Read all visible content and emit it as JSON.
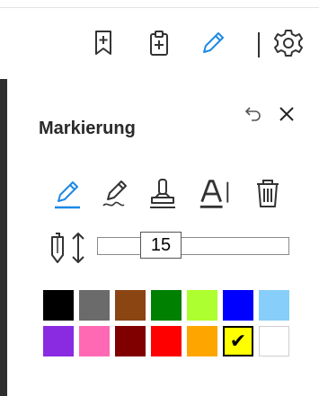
{
  "toolbar": {
    "icons": [
      "bookmark-add-icon",
      "clipboard-add-icon",
      "pen-icon",
      "settings-icon"
    ]
  },
  "panel": {
    "title": "Markierung",
    "tools": [
      "highlighter-pen-icon",
      "freehand-pen-icon",
      "stamp-icon",
      "text-highlight-icon",
      "delete-icon"
    ],
    "active_tool": "highlighter-pen-icon",
    "stroke_size": "15",
    "colors": {
      "row1": [
        "#000000",
        "#6b6b6b",
        "#8b4513",
        "#008000",
        "#adff2f",
        "#0000ff",
        "#87cefa"
      ],
      "row2": [
        "#8a2be2",
        "#ff69b4",
        "#800000",
        "#ff0000",
        "#ffa500",
        "#ffff00",
        "#ffffff"
      ]
    },
    "selected_color": "#ffff00",
    "check_glyph": "✔"
  },
  "accent_color": "#1e88e5"
}
